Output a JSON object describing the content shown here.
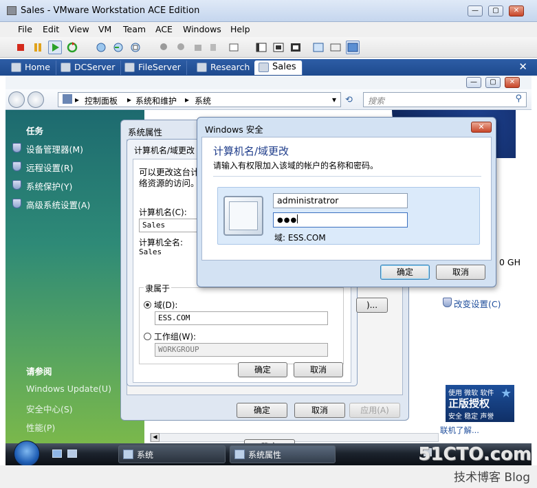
{
  "host": {
    "title": "Sales - VMware Workstation ACE Edition",
    "menu": [
      "File",
      "Edit",
      "View",
      "VM",
      "Team",
      "ACE",
      "Windows",
      "Help"
    ],
    "tabs": [
      {
        "label": "Home"
      },
      {
        "label": "DCServer"
      },
      {
        "label": "FileServer"
      },
      {
        "label": "Research"
      },
      {
        "label": "Sales",
        "active": true
      }
    ],
    "tab_close": "✕"
  },
  "guest": {
    "breadcrumb": [
      "控制面板",
      "系统和维护",
      "系统"
    ],
    "search_placeholder": "搜索",
    "sidebar": {
      "tasks_heading": "任务",
      "tasks": [
        "设备管理器(M)",
        "远程设置(R)",
        "系统保护(Y)",
        "高级系统设置(A)"
      ],
      "see_also_heading": "请参阅",
      "see_also": [
        "Windows Update(U)",
        "安全中心(S)",
        "性能(P)"
      ]
    },
    "right_fragments": {
      "ghz": "0 GH",
      "change_settings": "改变设置(C)",
      "genuine_line1": "使用 微软 软件",
      "genuine_line2": "正版授权",
      "genuine_line3": "安全 稳定 声誉",
      "learn_more": "联机了解..."
    }
  },
  "sysprop": {
    "title": "系统属性",
    "ok": "确定",
    "cancel": "取消",
    "apply": "应用(A)"
  },
  "cndlg": {
    "title": "计算机名/域更改",
    "intro_line1": "可以更改这台计",
    "intro_line2": "络资源的访问。",
    "computer_name_label": "计算机名(C):",
    "computer_name_value": "Sales",
    "full_name_label": "计算机全名:",
    "full_name_value": "Sales",
    "member_of": "隶属于",
    "domain_label": "域(D):",
    "domain_value": "ESS.COM",
    "workgroup_label": "工作组(W):",
    "workgroup_value": "WORKGROUP",
    "other_btn": ")...",
    "ok": "确定",
    "cancel": "取消"
  },
  "security": {
    "window_title": "Windows 安全",
    "heading": "计算机名/域更改",
    "subtitle": "请输入有权限加入该域的帐户的名称和密码。",
    "username": "administratror",
    "password_mask": "●●●",
    "domain_line": "域: ESS.COM",
    "ok": "确定",
    "cancel": "取消"
  },
  "taskbar": {
    "items": [
      "系统",
      "系统属性"
    ]
  },
  "watermark": {
    "line1": "51CTO.com",
    "line2": "技术博客  Blog"
  }
}
